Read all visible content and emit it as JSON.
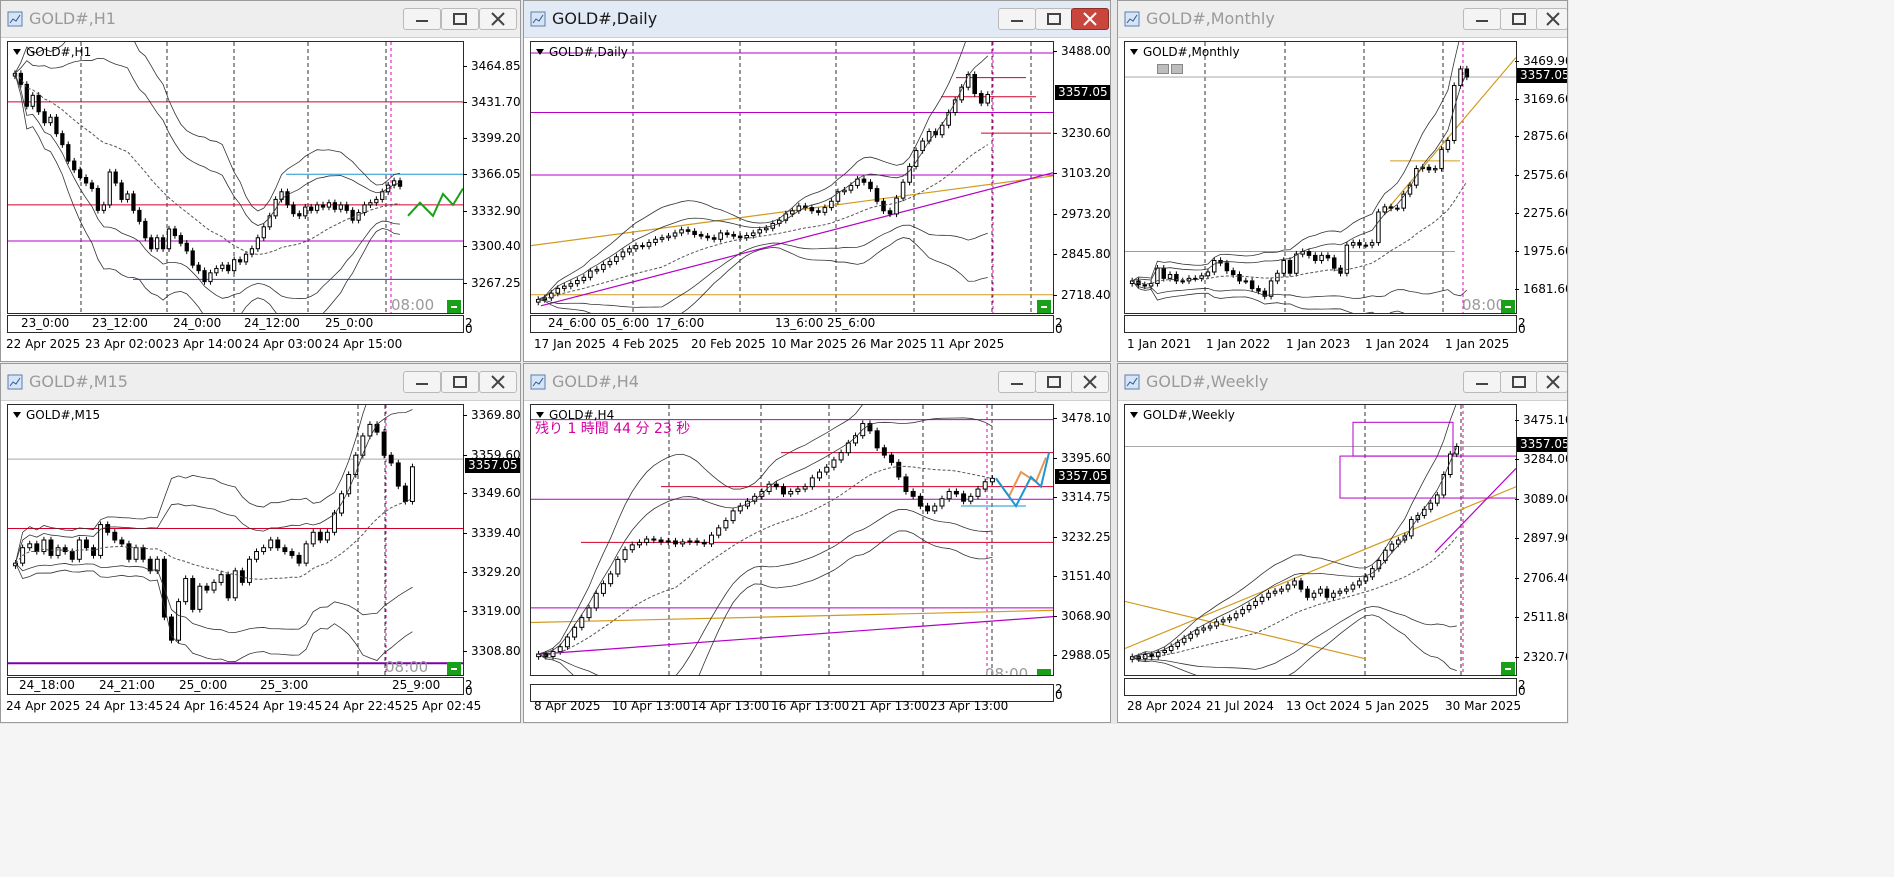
{
  "price_tag": "3357.05",
  "time_label": "08:00",
  "sub_zero": "0",
  "sub_two": "2",
  "colors": {
    "magenta": "#b400c8",
    "red": "#d2002a",
    "blue": "#1e4bd2",
    "gold": "#d29a1e",
    "green": "#18a018",
    "cyan": "#1e96d2",
    "orange": "#e69650",
    "pink": "#e600b4"
  },
  "windows": [
    {
      "title": "GOLD#,H1",
      "symbol": "GOLD#,H1",
      "ymin": 3245,
      "ymax": 3485,
      "ticks": [
        "3464.85",
        "3431.70",
        "3399.20",
        "3366.05",
        "3332.90",
        "3300.40",
        "3267.25"
      ],
      "xlabels": [
        "22 Apr 2025",
        "23 Apr 02:00",
        "23 Apr 14:00",
        "24 Apr 03:00",
        "24 Apr 15:00"
      ],
      "sublabels": [
        "23_0:00",
        "23_12:00",
        "24_0:00",
        "24_12:00",
        "25_0:00"
      ],
      "show_time": true
    },
    {
      "title": "GOLD#,Daily",
      "symbol": "GOLD#,Daily",
      "ymin": 2680,
      "ymax": 3510,
      "ticks": [
        "3488.00",
        "3357.05",
        "3230.60",
        "3103.20",
        "2973.20",
        "2845.80",
        "2718.40"
      ],
      "xlabels": [
        "17 Jan 2025",
        "4 Feb 2025",
        "20 Feb 2025",
        "10 Mar 2025",
        "26 Mar 2025",
        "11 Apr 2025"
      ],
      "sublabels": [
        "24_6:00",
        "05_6:00",
        "17_6:00",
        "13_6:00",
        "25_6:00"
      ],
      "show_time": false
    },
    {
      "title": "GOLD#,Monthly",
      "symbol": "GOLD#,Monthly",
      "ymin": 1540,
      "ymax": 3600,
      "ticks": [
        "3469.90",
        "3357.05",
        "3169.60",
        "2875.60",
        "2575.60",
        "2275.60",
        "1975.60",
        "1681.60"
      ],
      "xlabels": [
        "1 Jan 2021",
        "1 Jan 2022",
        "1 Jan 2023",
        "1 Jan 2024",
        "1 Jan 2025"
      ],
      "sublabels": [],
      "show_time": true
    },
    {
      "title": "GOLD#,M15",
      "symbol": "GOLD#,M15",
      "ymin": 3304,
      "ymax": 3372,
      "ticks": [
        "3369.80",
        "3359.60",
        "3357.05",
        "3349.60",
        "3339.40",
        "3329.20",
        "3319.00",
        "3308.80"
      ],
      "xlabels": [
        "24 Apr 2025",
        "24 Apr 13:45",
        "24 Apr 16:45",
        "24 Apr 19:45",
        "24 Apr 22:45",
        "25 Apr 02:45"
      ],
      "sublabels": [
        "24_18:00",
        "24_21:00",
        "25_0:00",
        "25_3:00",
        "25_9:00"
      ],
      "show_time": true
    },
    {
      "title": "GOLD#,H4",
      "symbol": "GOLD#,H4",
      "ymin": 2960,
      "ymax": 3500,
      "ticks": [
        "3478.10",
        "3395.60",
        "3357.05",
        "3314.75",
        "3232.25",
        "3151.40",
        "3068.90",
        "2988.05"
      ],
      "xlabels": [
        "8 Apr 2025",
        "10 Apr 13:00",
        "14 Apr 13:00",
        "16 Apr 13:00",
        "21 Apr 13:00",
        "23 Apr 13:00"
      ],
      "sublabels": [],
      "show_time": true,
      "countdown": "残り 1 時間 44 分 23 秒"
    },
    {
      "title": "GOLD#,Weekly",
      "symbol": "GOLD#,Weekly",
      "ymin": 2260,
      "ymax": 3540,
      "ticks": [
        "3475.10",
        "3357.05",
        "3284.00",
        "3089.00",
        "2897.90",
        "2706.40",
        "2511.80",
        "2320.70"
      ],
      "xlabels": [
        "28 Apr 2024",
        "21 Jul 2024",
        "13 Oct 2024",
        "5 Jan 2025",
        "30 Mar 2025"
      ],
      "sublabels": [],
      "show_time": false
    }
  ],
  "chart_data": [
    {
      "type": "candlestick",
      "title": "GOLD#,H1",
      "ylim": [
        3245,
        3485
      ],
      "closes": [
        3460,
        3450,
        3430,
        3440,
        3425,
        3415,
        3420,
        3405,
        3395,
        3380,
        3372,
        3365,
        3360,
        3355,
        3335,
        3340,
        3370,
        3360,
        3345,
        3350,
        3335,
        3325,
        3310,
        3300,
        3310,
        3300,
        3318,
        3312,
        3305,
        3298,
        3285,
        3280,
        3270,
        3278,
        3282,
        3285,
        3280,
        3290,
        3288,
        3295,
        3300,
        3310,
        3320,
        3330,
        3345,
        3352,
        3340,
        3332,
        3330,
        3338,
        3335,
        3340,
        3338,
        3342,
        3336,
        3340,
        3335,
        3326,
        3333,
        3340,
        3342,
        3345,
        3352,
        3358,
        3362,
        3357
      ]
    },
    {
      "type": "candlestick",
      "title": "GOLD#,Daily",
      "ylim": [
        2680,
        3510
      ],
      "closes": [
        2710,
        2715,
        2730,
        2745,
        2752,
        2760,
        2770,
        2780,
        2800,
        2805,
        2820,
        2830,
        2845,
        2860,
        2870,
        2880,
        2878,
        2890,
        2900,
        2905,
        2910,
        2920,
        2930,
        2925,
        2915,
        2910,
        2905,
        2900,
        2920,
        2915,
        2910,
        2905,
        2912,
        2920,
        2930,
        2935,
        2950,
        2960,
        2980,
        2990,
        3005,
        3000,
        2990,
        2985,
        3000,
        3020,
        3050,
        3055,
        3070,
        3090,
        3080,
        3060,
        3020,
        2990,
        2980,
        3030,
        3080,
        3130,
        3180,
        3210,
        3240,
        3230,
        3260,
        3300,
        3340,
        3380,
        3420,
        3360,
        3330,
        3357
      ]
    },
    {
      "type": "candlestick",
      "title": "GOLD#,Monthly",
      "ylim": [
        1540,
        3600
      ],
      "closes": [
        1760,
        1730,
        1720,
        1740,
        1860,
        1780,
        1810,
        1760,
        1760,
        1780,
        1780,
        1800,
        1830,
        1920,
        1900,
        1840,
        1810,
        1760,
        1760,
        1700,
        1680,
        1640,
        1760,
        1820,
        1920,
        1820,
        1970,
        1990,
        1960,
        1920,
        1960,
        1940,
        1860,
        1820,
        2040,
        2060,
        2040,
        2040,
        2060,
        2300,
        2340,
        2330,
        2330,
        2440,
        2510,
        2640,
        2650,
        2630,
        2640,
        2790,
        2860,
        3290,
        3420,
        3357
      ]
    },
    {
      "type": "candlestick",
      "title": "GOLD#,M15",
      "ylim": [
        3304,
        3372
      ],
      "closes": [
        3332,
        3336,
        3337,
        3335,
        3338,
        3334,
        3336,
        3335,
        3333,
        3338,
        3336,
        3334,
        3342,
        3340,
        3338,
        3337,
        3333,
        3336,
        3333,
        3330,
        3333,
        3318,
        3312,
        3322,
        3328,
        3320,
        3326,
        3325,
        3327,
        3329,
        3323,
        3330,
        3327,
        3333,
        3335,
        3336,
        3338,
        3336,
        3335,
        3334,
        3332,
        3337,
        3340,
        3338,
        3340,
        3345,
        3350,
        3355,
        3360,
        3365,
        3368,
        3366,
        3360,
        3358,
        3352,
        3348,
        3357
      ]
    },
    {
      "type": "candlestick",
      "title": "GOLD#,H4",
      "ylim": [
        2960,
        3500
      ],
      "closes": [
        2995,
        2990,
        3000,
        3010,
        3030,
        3050,
        3070,
        3090,
        3120,
        3140,
        3160,
        3190,
        3210,
        3220,
        3225,
        3232,
        3230,
        3226,
        3228,
        3222,
        3226,
        3228,
        3225,
        3222,
        3240,
        3255,
        3270,
        3290,
        3300,
        3310,
        3320,
        3330,
        3345,
        3340,
        3325,
        3330,
        3335,
        3340,
        3358,
        3370,
        3380,
        3395,
        3410,
        3430,
        3445,
        3470,
        3455,
        3420,
        3405,
        3390,
        3360,
        3330,
        3320,
        3300,
        3290,
        3300,
        3315,
        3330,
        3325,
        3310,
        3320,
        3335,
        3350,
        3357
      ]
    },
    {
      "type": "candlestick",
      "title": "GOLD#,Weekly",
      "ylim": [
        2260,
        3540
      ],
      "closes": [
        2330,
        2320,
        2340,
        2330,
        2350,
        2360,
        2380,
        2400,
        2420,
        2440,
        2460,
        2470,
        2480,
        2500,
        2510,
        2520,
        2540,
        2560,
        2580,
        2600,
        2620,
        2640,
        2650,
        2660,
        2680,
        2700,
        2660,
        2620,
        2640,
        2660,
        2620,
        2640,
        2650,
        2660,
        2680,
        2700,
        2720,
        2760,
        2800,
        2850,
        2880,
        2900,
        2920,
        3000,
        3020,
        3050,
        3080,
        3120,
        3220,
        3320,
        3357
      ]
    }
  ]
}
